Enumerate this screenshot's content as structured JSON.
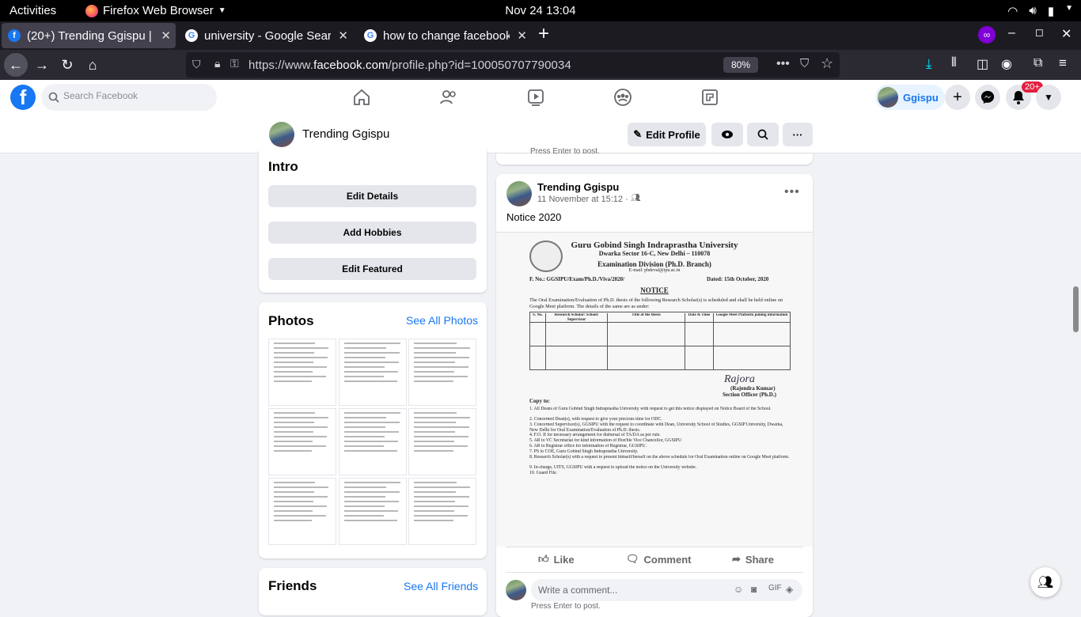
{
  "gnome": {
    "activities": "Activities",
    "app_name": "Firefox Web Browser",
    "clock": "Nov 24  13:04"
  },
  "tabs": [
    {
      "title": "(20+) Trending Ggispu | F",
      "active": true
    },
    {
      "title": "university - Google Searc",
      "active": false
    },
    {
      "title": "how to change facebook",
      "active": false
    }
  ],
  "nav": {
    "url_prefix": "https://www.",
    "url_domain": "facebook.com",
    "url_path": "/profile.php?id=100050707790034",
    "zoom": "80%"
  },
  "fb_header": {
    "search_placeholder": "Search Facebook",
    "profile_name": "Ggispu",
    "notif_count": "20+"
  },
  "profile_bar": {
    "name": "Trending Ggispu",
    "edit_profile": "Edit Profile"
  },
  "intro": {
    "title": "Intro",
    "buttons": [
      "Edit Details",
      "Add Hobbies",
      "Edit Featured"
    ]
  },
  "photos": {
    "title": "Photos",
    "see_all": "See All Photos"
  },
  "friends": {
    "title": "Friends",
    "see_all": "See All Friends"
  },
  "post": {
    "prev_hint": "Press Enter to post.",
    "author": "Trending Ggispu",
    "time": "11 November at 15:12 ·",
    "text": "Notice 2020",
    "doc": {
      "university": "Guru Gobind Singh Indraprastha University",
      "address": "Dwarka Sector 16-C, New Delhi – 110078",
      "division": "Examination Division (Ph.D. Branch)",
      "email": "E-mail: phdeval@ipu.ac.in",
      "ref": "F. No.: GGSIPU/Exam/Ph.D./Viva/2020/",
      "dated": "Dated: 15th October, 2020",
      "notice": "NOTICE",
      "intro": "The Oral Examination/Evaluation of Ph.D. thesis of the following Research Scholar(s) is scheduled and shall be held online on Google Meet platform. The details of the same are as under:",
      "table_headers": [
        "S. No.",
        "Research Scholar/ School/ Supervisor",
        "Title of the thesis",
        "Date & Time",
        "Google Meet Platform joining information"
      ],
      "signatory": "(Rajendra Kumar)",
      "signatory_title": "Section Officer (Ph.D.)",
      "copy_to": "Copy to:",
      "copy_items": [
        "All Deans of Guru Gobind Singh Indraprastha University with request to get this notice displayed on Notice Board of the School.",
        "Concerned Dean(s), with request to give your precious time for ODC.",
        "Concerned Supervisor(s), GGSIPU with the request to coordinate with Dean, University School of Studies, GGSIP University, Dwarka, New Delhi for Oral Examination/Evaluation of Ph.D. thesis.",
        "F.O. II for necessary arrangement for disbursal of TA/DA as per rule.",
        "AR to VC Secretariat for kind information of Hon'ble Vice Chancellor, GGSIPU",
        "AR to Registrar office for information of Registrar, GGSIPU.",
        "PS to COE, Guru Gobind Singh Indraprastha University.",
        "Research Scholar(s) with a request to present himself/herself on the above schedule for Oral Examination online on Google Meet platform.",
        "In-charge, UITS, GGSIPU with a request to upload the notice on the University website.",
        "Guard File."
      ]
    },
    "like": "Like",
    "comment": "Comment",
    "share": "Share",
    "comment_placeholder": "Write a comment...",
    "press_enter": "Press Enter to post."
  },
  "colors": {
    "fb_blue": "#1877f2",
    "firefox_bar": "#2b2a33",
    "badge_red": "#e41e3f"
  }
}
